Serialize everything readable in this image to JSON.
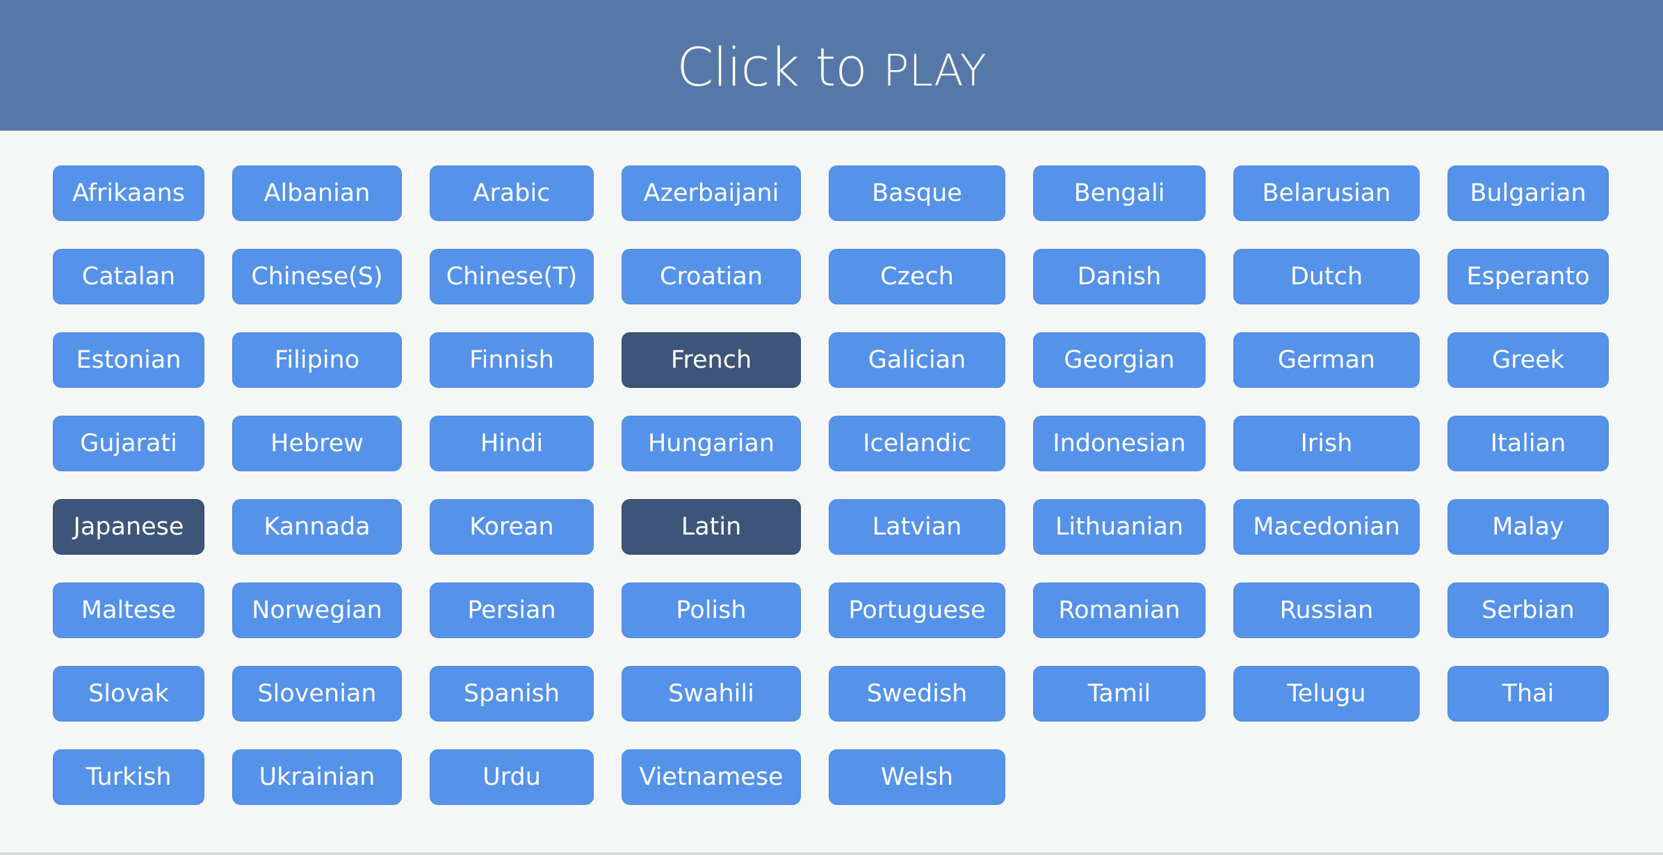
{
  "header": {
    "title_main": "Click to",
    "title_play": "PLAY"
  },
  "colors": {
    "header_bg": "#5678a8",
    "button": "#5592e9",
    "button_selected": "#3d5578",
    "background": "#f5f7f6"
  },
  "languages": [
    {
      "label": "Afrikaans",
      "selected": false
    },
    {
      "label": "Albanian",
      "selected": false
    },
    {
      "label": "Arabic",
      "selected": false
    },
    {
      "label": "Azerbaijani",
      "selected": false
    },
    {
      "label": "Basque",
      "selected": false
    },
    {
      "label": "Bengali",
      "selected": false
    },
    {
      "label": "Belarusian",
      "selected": false
    },
    {
      "label": "Bulgarian",
      "selected": false
    },
    {
      "label": "Catalan",
      "selected": false
    },
    {
      "label": "Chinese(S)",
      "selected": false
    },
    {
      "label": "Chinese(T)",
      "selected": false
    },
    {
      "label": "Croatian",
      "selected": false
    },
    {
      "label": "Czech",
      "selected": false
    },
    {
      "label": "Danish",
      "selected": false
    },
    {
      "label": "Dutch",
      "selected": false
    },
    {
      "label": "Esperanto",
      "selected": false
    },
    {
      "label": "Estonian",
      "selected": false
    },
    {
      "label": "Filipino",
      "selected": false
    },
    {
      "label": "Finnish",
      "selected": false
    },
    {
      "label": "French",
      "selected": true
    },
    {
      "label": "Galician",
      "selected": false
    },
    {
      "label": "Georgian",
      "selected": false
    },
    {
      "label": "German",
      "selected": false
    },
    {
      "label": "Greek",
      "selected": false
    },
    {
      "label": "Gujarati",
      "selected": false
    },
    {
      "label": "Hebrew",
      "selected": false
    },
    {
      "label": "Hindi",
      "selected": false
    },
    {
      "label": "Hungarian",
      "selected": false
    },
    {
      "label": "Icelandic",
      "selected": false
    },
    {
      "label": "Indonesian",
      "selected": false
    },
    {
      "label": "Irish",
      "selected": false
    },
    {
      "label": "Italian",
      "selected": false
    },
    {
      "label": "Japanese",
      "selected": true
    },
    {
      "label": "Kannada",
      "selected": false
    },
    {
      "label": "Korean",
      "selected": false
    },
    {
      "label": "Latin",
      "selected": true
    },
    {
      "label": "Latvian",
      "selected": false
    },
    {
      "label": "Lithuanian",
      "selected": false
    },
    {
      "label": "Macedonian",
      "selected": false
    },
    {
      "label": "Malay",
      "selected": false
    },
    {
      "label": "Maltese",
      "selected": false
    },
    {
      "label": "Norwegian",
      "selected": false
    },
    {
      "label": "Persian",
      "selected": false
    },
    {
      "label": "Polish",
      "selected": false
    },
    {
      "label": "Portuguese",
      "selected": false
    },
    {
      "label": "Romanian",
      "selected": false
    },
    {
      "label": "Russian",
      "selected": false
    },
    {
      "label": "Serbian",
      "selected": false
    },
    {
      "label": "Slovak",
      "selected": false
    },
    {
      "label": "Slovenian",
      "selected": false
    },
    {
      "label": "Spanish",
      "selected": false
    },
    {
      "label": "Swahili",
      "selected": false
    },
    {
      "label": "Swedish",
      "selected": false
    },
    {
      "label": "Tamil",
      "selected": false
    },
    {
      "label": "Telugu",
      "selected": false
    },
    {
      "label": "Thai",
      "selected": false
    },
    {
      "label": "Turkish",
      "selected": false
    },
    {
      "label": "Ukrainian",
      "selected": false
    },
    {
      "label": "Urdu",
      "selected": false
    },
    {
      "label": "Vietnamese",
      "selected": false
    },
    {
      "label": "Welsh",
      "selected": false
    }
  ]
}
